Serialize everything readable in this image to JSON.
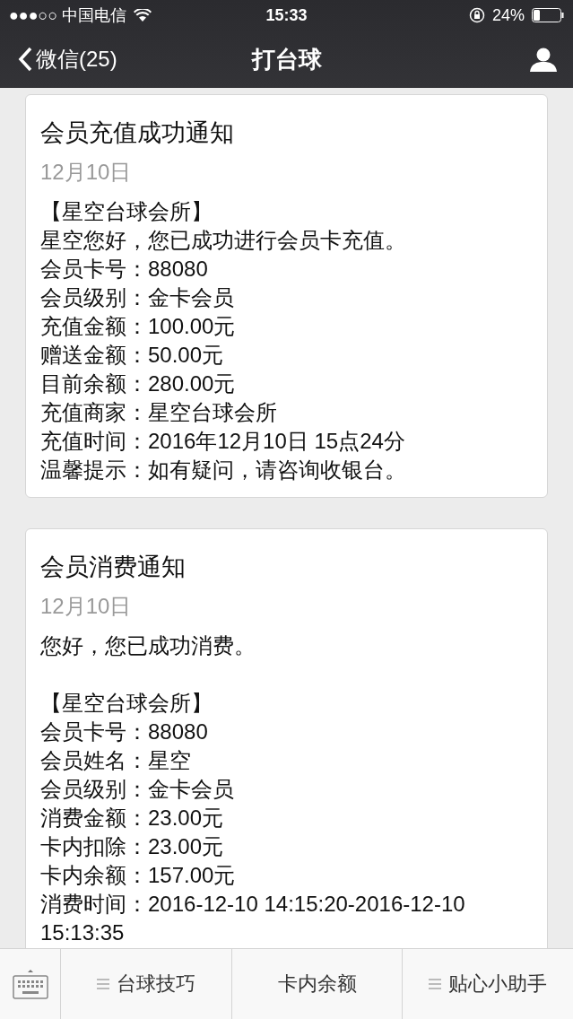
{
  "status_bar": {
    "carrier": "●●●○○ 中国电信",
    "time": "15:33",
    "battery": "24%"
  },
  "nav": {
    "back": "微信(25)",
    "title": "打台球"
  },
  "cards": [
    {
      "title": "会员充值成功通知",
      "date": "12月10日",
      "lines": [
        "【星空台球会所】",
        "星空您好，您已成功进行会员卡充值。",
        "会员卡号：88080",
        "会员级别：金卡会员",
        "充值金额：100.00元",
        "赠送金额：50.00元",
        "目前余额：280.00元",
        "充值商家：星空台球会所",
        "充值时间：2016年12月10日 15点24分",
        "温馨提示：如有疑问，请咨询收银台。"
      ]
    },
    {
      "title": "会员消费通知",
      "date": "12月10日",
      "intro": "您好，您已成功消费。",
      "lines": [
        "【星空台球会所】",
        "会员卡号：88080",
        "会员姓名：星空",
        "会员级别：金卡会员",
        "消费金额：23.00元",
        "卡内扣除：23.00元",
        "卡内余额：157.00元",
        "消费时间：2016-12-10 14:15:20-2016-12-10 15:13:35"
      ]
    }
  ],
  "menu": [
    {
      "label": "台球技巧",
      "has_submenu": true
    },
    {
      "label": "卡内余额",
      "has_submenu": false
    },
    {
      "label": "贴心小助手",
      "has_submenu": true
    }
  ]
}
